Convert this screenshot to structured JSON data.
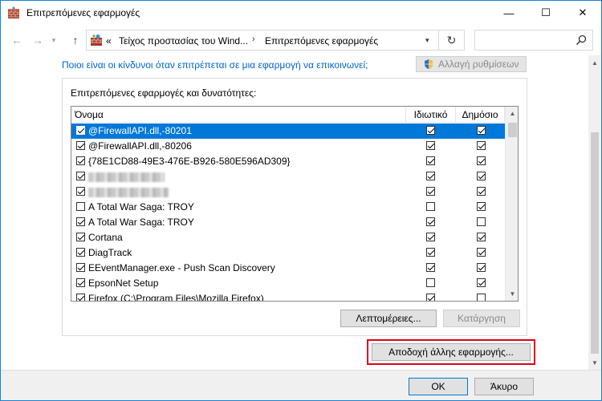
{
  "window": {
    "title": "Επιτρεπόμενες εφαρμογές",
    "controls": {
      "minimize": "—",
      "maximize": "☐",
      "close": "✕"
    }
  },
  "nav": {
    "back": "←",
    "forward": "→",
    "dropdown": "▾",
    "up": "↑",
    "address": {
      "ellipsis": "«",
      "segment1": "Τείχος προστασίας του Wind...",
      "separator": "›",
      "segment2": "Επιτρεπόμενες εφαρμογές",
      "dropdown": "▾"
    },
    "refresh": "↻",
    "search_placeholder": ""
  },
  "content": {
    "risk_link": "Ποιοι είναι οι κίνδυνοι όταν επιτρέπεται σε μια εφαρμογή να επικοινωνεί;",
    "change_settings": "Αλλαγή ρυθμίσεων",
    "group_label": "Επιτρεπόμενες εφαρμογές και δυνατότητες:",
    "columns": {
      "name": "Όνομα",
      "private": "Ιδιωτικό",
      "public": "Δημόσιο"
    },
    "rows": [
      {
        "name": "@FirewallAPI.dll,-80201",
        "enabled": true,
        "private": true,
        "public": true,
        "selected": true
      },
      {
        "name": "@FirewallAPI.dll,-80206",
        "enabled": true,
        "private": true,
        "public": true
      },
      {
        "name": "{78E1CD88-49E3-476E-B926-580E596AD309}",
        "enabled": true,
        "private": true,
        "public": true
      },
      {
        "name": "",
        "enabled": true,
        "private": true,
        "public": true,
        "redacted": true
      },
      {
        "name": "",
        "enabled": true,
        "private": true,
        "public": true,
        "redacted": true
      },
      {
        "name": "A Total War Saga: TROY",
        "enabled": false,
        "private": false,
        "public": true
      },
      {
        "name": "A Total War Saga: TROY",
        "enabled": true,
        "private": true,
        "public": false
      },
      {
        "name": "Cortana",
        "enabled": true,
        "private": true,
        "public": true
      },
      {
        "name": "DiagTrack",
        "enabled": true,
        "private": true,
        "public": true
      },
      {
        "name": "EEventManager.exe - Push Scan Discovery",
        "enabled": true,
        "private": true,
        "public": true
      },
      {
        "name": "EpsonNet Setup",
        "enabled": true,
        "private": false,
        "public": true
      },
      {
        "name": "Firefox (C:\\Program Files\\Mozilla Firefox)",
        "enabled": true,
        "private": true,
        "public": false
      }
    ],
    "details_button": "Λεπτομέρειες...",
    "remove_button": "Κατάργηση",
    "allow_other_button": "Αποδοχή άλλης εφαρμογής..."
  },
  "footer": {
    "ok": "OK",
    "cancel": "Άκυρο"
  },
  "colors": {
    "accent": "#0078d7",
    "link": "#0066cc",
    "highlight_box": "#e0001b"
  }
}
